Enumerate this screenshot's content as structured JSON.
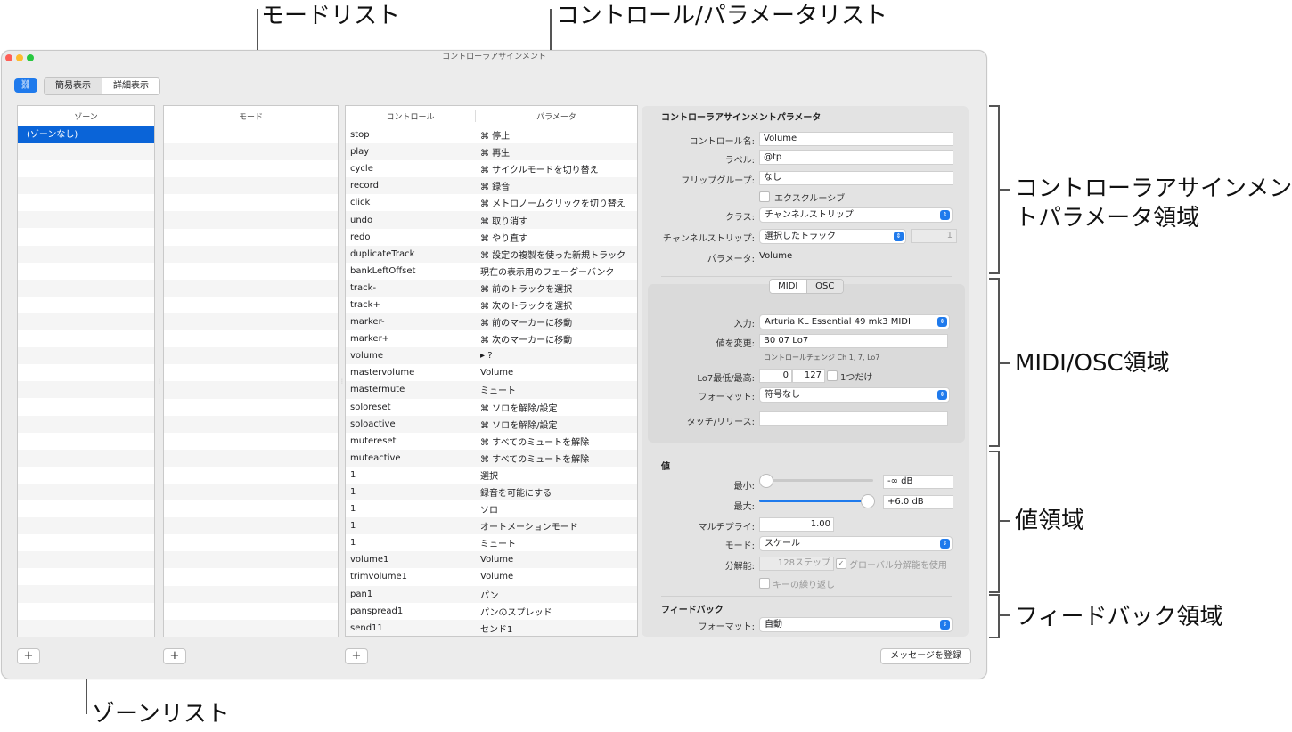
{
  "callouts": {
    "mode_list": "モードリスト",
    "control_param_list": "コントロール/パラメータリスト",
    "assignment_params_area_1": "コントローラアサインメン",
    "assignment_params_area_2": "トパラメータ領域",
    "midi_osc_area": "MIDI/OSC領域",
    "value_area": "値領域",
    "feedback_area": "フィードバック領域",
    "zone_list": "ゾーンリスト"
  },
  "window": {
    "title": "コントローラアサインメント",
    "link_icon": "link-icon",
    "view_simple": "簡易表示",
    "view_detail": "詳細表示",
    "register_message": "メッセージを登録",
    "add_symbol": "+"
  },
  "zone_list": {
    "header": "ゾーン",
    "selected": "(ゾーンなし)"
  },
  "mode_list": {
    "header": "モード"
  },
  "control_list": {
    "header_control": "コントロール",
    "header_param": "パラメータ",
    "rows": [
      {
        "control": "stop",
        "param": "⌘ 停止"
      },
      {
        "control": "play",
        "param": "⌘ 再生"
      },
      {
        "control": "cycle",
        "param": "⌘ サイクルモードを切り替え"
      },
      {
        "control": "record",
        "param": "⌘ 録音"
      },
      {
        "control": "click",
        "param": "⌘ メトロノームクリックを切り替え"
      },
      {
        "control": "undo",
        "param": "⌘ 取り消す"
      },
      {
        "control": "redo",
        "param": "⌘ やり直す"
      },
      {
        "control": "duplicateTrack",
        "param": "⌘ 設定の複製を使った新規トラック"
      },
      {
        "control": "bankLeftOffset",
        "param": "現在の表示用のフェーダーバンク"
      },
      {
        "control": "track-",
        "param": "⌘ 前のトラックを選択"
      },
      {
        "control": "track+",
        "param": "⌘ 次のトラックを選択"
      },
      {
        "control": "marker-",
        "param": "⌘ 前のマーカーに移動"
      },
      {
        "control": "marker+",
        "param": "⌘ 次のマーカーに移動"
      },
      {
        "control": "volume",
        "param": "▸ ?"
      },
      {
        "control": "mastervolume",
        "param": "Volume"
      },
      {
        "control": "mastermute",
        "param": "ミュート"
      },
      {
        "control": "soloreset",
        "param": "⌘ ソロを解除/設定"
      },
      {
        "control": "soloactive",
        "param": "⌘ ソロを解除/設定"
      },
      {
        "control": "mutereset",
        "param": "⌘ すべてのミュートを解除"
      },
      {
        "control": "muteactive",
        "param": "⌘ すべてのミュートを解除"
      },
      {
        "control": "1",
        "param": "選択"
      },
      {
        "control": "1",
        "param": "録音を可能にする"
      },
      {
        "control": "1",
        "param": "ソロ"
      },
      {
        "control": "1",
        "param": "オートメーションモード"
      },
      {
        "control": "1",
        "param": "ミュート"
      },
      {
        "control": "volume1",
        "param": "Volume"
      },
      {
        "control": "trimvolume1",
        "param": "Volume"
      },
      {
        "control": "pan1",
        "param": "パン"
      },
      {
        "control": "panspread1",
        "param": "パンのスプレッド"
      },
      {
        "control": "send11",
        "param": "センド1"
      }
    ]
  },
  "assignment": {
    "title": "コントローラアサインメントパラメータ",
    "control_name_label": "コントロール名:",
    "control_name_value": "Volume",
    "label_label": "ラベル:",
    "label_value": "@tp",
    "flip_group_label": "フリップグループ:",
    "flip_group_value": "なし",
    "exclusive_label": "エクスクルーシブ",
    "class_label": "クラス:",
    "class_value": "チャンネルストリップ",
    "channel_strip_label": "チャンネルストリップ:",
    "channel_strip_value": "選択したトラック",
    "channel_strip_number": "1",
    "parameter_label": "パラメータ:",
    "parameter_value": "Volume"
  },
  "midi_osc": {
    "tab_midi": "MIDI",
    "tab_osc": "OSC",
    "input_label": "入力:",
    "input_value": "Arturia KL Essential 49 mk3 MIDI",
    "value_change_label": "値を変更:",
    "value_change_value": "B0 07 Lo7",
    "value_change_desc": "コントロールチェンジ Ch 1, 7, Lo7",
    "lo7_label": "Lo7最低/最高:",
    "lo7_min": "0",
    "lo7_max": "127",
    "only_one_label": "1つだけ",
    "format_label": "フォーマット:",
    "format_value": "符号なし",
    "touch_release_label": "タッチ/リリース:",
    "touch_release_value": ""
  },
  "value": {
    "title": "値",
    "min_label": "最小:",
    "min_value": "-∞ dB",
    "min_position": 0.0,
    "max_label": "最大:",
    "max_value": "+6.0 dB",
    "max_position": 1.0,
    "multiply_label": "マルチプライ:",
    "multiply_value": "1.00",
    "mode_label": "モード:",
    "mode_value": "スケール",
    "resolution_label": "分解能:",
    "resolution_value": "128ステップ",
    "global_resolution_label": "グローバル分解能を使用",
    "key_repeat_label": "キーの繰り返し"
  },
  "feedback": {
    "title": "フィードバック",
    "format_label": "フォーマット:",
    "format_value": "自動"
  },
  "colors": {
    "accent": "#1f7aec",
    "selection": "#0a64d8",
    "close": "#fe5f57",
    "minimize": "#febc2e",
    "zoom": "#28c840"
  }
}
